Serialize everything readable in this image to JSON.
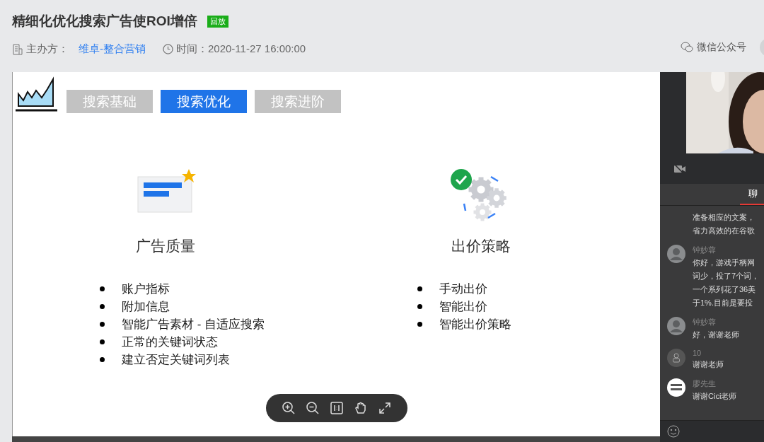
{
  "header": {
    "title": "精细化优化搜索广告使ROI增倍",
    "badge": "回放",
    "organizer_label": "主办方：",
    "organizer": "维卓-整合营销",
    "time_label": "时间：",
    "time": "2020-11-27 16:00:00",
    "share": "微信公众号"
  },
  "slide": {
    "tabs": [
      {
        "label": "搜索基础",
        "selected": false
      },
      {
        "label": "搜索优化",
        "selected": true
      },
      {
        "label": "搜索进阶",
        "selected": false
      }
    ],
    "sections": [
      {
        "title": "广告质量",
        "bullets": [
          "账户指标",
          "附加信息",
          "智能广告素材 - 自适应搜索",
          "正常的关键词状态",
          "建立否定关键词列表"
        ]
      },
      {
        "title": "出价策略",
        "bullets": [
          "手动出价",
          "智能出价",
          "智能出价策略"
        ]
      }
    ]
  },
  "side_panel": {
    "chat_tab": {
      "label": "聊",
      "selected": true
    },
    "messages": [
      {
        "lines": [
          "准备相应的文案，",
          "省力高效的在谷歌"
        ]
      },
      {
        "sender": "钟妙蓉",
        "lines": [
          "你好，游戏手柄网",
          "词少，投了7个词，",
          "一个系列花了36美",
          "于1%.目前是要投"
        ]
      },
      {
        "sender": "钟妙蓉",
        "lines": [
          "好，谢谢老师"
        ]
      },
      {
        "sender": "10",
        "kind": "default",
        "lines": [
          "谢谢老师"
        ]
      },
      {
        "sender": "廖先生",
        "kind": "logo",
        "lines": [
          "谢谢Cici老师"
        ]
      }
    ]
  }
}
